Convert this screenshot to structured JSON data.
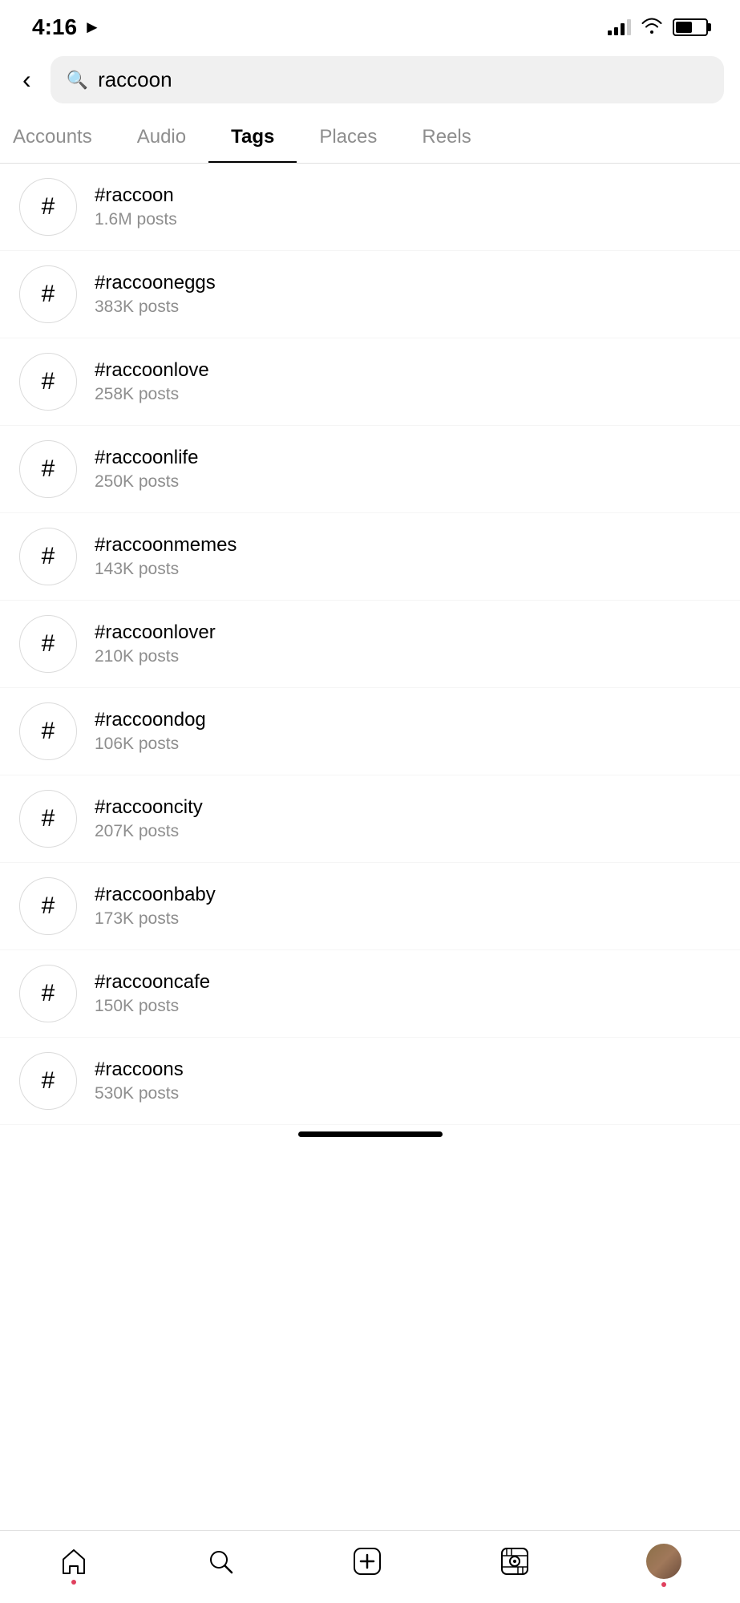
{
  "statusBar": {
    "time": "4:16",
    "signal": [
      true,
      true,
      true,
      false
    ],
    "battery_percent": 55
  },
  "search": {
    "query": "raccoon",
    "placeholder": "Search"
  },
  "tabs": [
    {
      "id": "accounts",
      "label": "Accounts",
      "active": false,
      "partial": true
    },
    {
      "id": "audio",
      "label": "Audio",
      "active": false
    },
    {
      "id": "tags",
      "label": "Tags",
      "active": true
    },
    {
      "id": "places",
      "label": "Places",
      "active": false
    },
    {
      "id": "reels",
      "label": "Reels",
      "active": false
    }
  ],
  "tags": [
    {
      "id": 1,
      "name": "#raccoon",
      "posts": "1.6M posts"
    },
    {
      "id": 2,
      "name": "#raccooneggs",
      "posts": "383K posts"
    },
    {
      "id": 3,
      "name": "#raccoonlove",
      "posts": "258K posts"
    },
    {
      "id": 4,
      "name": "#raccoonlife",
      "posts": "250K posts"
    },
    {
      "id": 5,
      "name": "#raccoonmemes",
      "posts": "143K posts"
    },
    {
      "id": 6,
      "name": "#raccoonlover",
      "posts": "210K posts"
    },
    {
      "id": 7,
      "name": "#raccoondog",
      "posts": "106K posts"
    },
    {
      "id": 8,
      "name": "#raccooncity",
      "posts": "207K posts"
    },
    {
      "id": 9,
      "name": "#raccoonbaby",
      "posts": "173K posts"
    },
    {
      "id": 10,
      "name": "#raccooncafe",
      "posts": "150K posts"
    },
    {
      "id": 11,
      "name": "#raccoons",
      "posts": "530K posts"
    }
  ],
  "bottomNav": {
    "items": [
      {
        "id": "home",
        "label": "Home",
        "has_dot": true
      },
      {
        "id": "search",
        "label": "Search",
        "has_dot": false
      },
      {
        "id": "add",
        "label": "Add",
        "has_dot": false
      },
      {
        "id": "reels",
        "label": "Reels",
        "has_dot": false
      },
      {
        "id": "profile",
        "label": "Profile",
        "has_dot": true
      }
    ]
  }
}
